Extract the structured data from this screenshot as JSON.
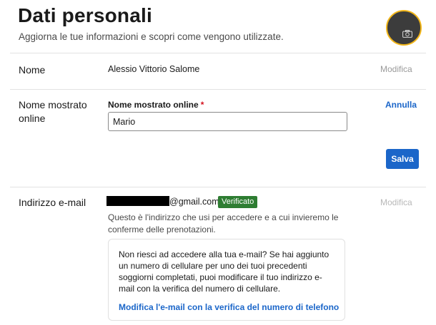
{
  "header": {
    "title": "Dati personali",
    "subtitle": "Aggiorna le tue informazioni e scopri come vengono utilizzate."
  },
  "avatar": {
    "icon": "camera-icon",
    "border_color": "#f2b619"
  },
  "name_row": {
    "label": "Nome",
    "value": "Alessio Vittorio Salome",
    "action": "Modifica"
  },
  "display_name_row": {
    "label": "Nome mostrato online",
    "field_label": "Nome mostrato online",
    "required_mark": "*",
    "input_value": "Mario",
    "cancel": "Annulla",
    "save": "Salva"
  },
  "email_row": {
    "label": "Indirizzo e-mail",
    "email_domain": "@gmail.com",
    "badge": "Verificato",
    "action": "Modifica",
    "help": "Questo è l'indirizzo che usi per accedere e a cui invieremo le conferme delle prenotazioni.",
    "info_box": {
      "text": "Non riesci ad accedere alla tua e-mail? Se hai aggiunto un numero di cellulare per uno dei tuoi precedenti soggiorni completati, puoi modificare il tuo indirizzo e-mail con la verifica del numero di cellulare.",
      "link": "Modifica l'e-mail con la verifica del numero di telefono"
    }
  },
  "colors": {
    "accent": "#1b66c9",
    "verified": "#2e7d32",
    "required": "#d4111e"
  }
}
